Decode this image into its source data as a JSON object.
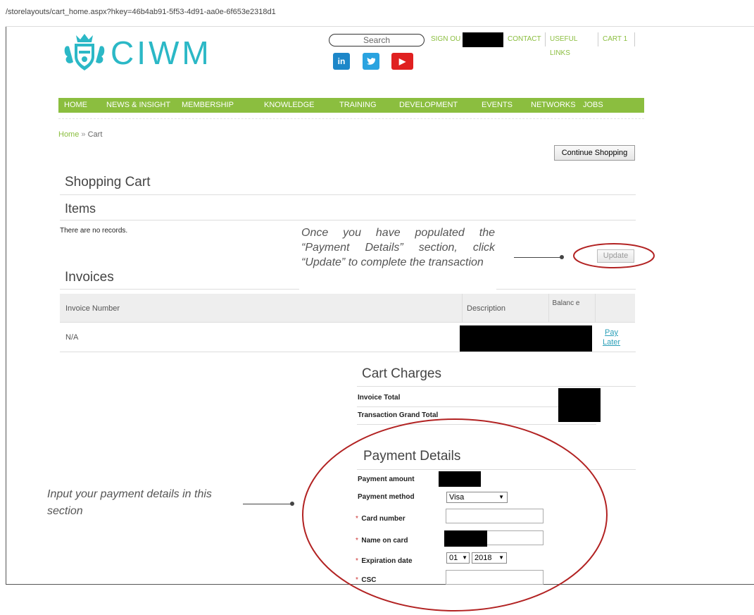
{
  "browser": {
    "url": "/storelayouts/cart_home.aspx?hkey=46b4ab91-5f53-4d91-aa0e-6f653e2318d1"
  },
  "header": {
    "logo_text": "CIWM",
    "search_placeholder": "Search",
    "links": {
      "sign_out": "SIGN OU",
      "contact": "CONTACT",
      "useful_links": "USEFUL LINKS",
      "cart": "CART 1"
    },
    "social": {
      "linkedin": "in",
      "twitter": "t",
      "youtube": "▶"
    }
  },
  "nav": {
    "items": [
      "HOME",
      "NEWS & INSIGHT",
      "MEMBERSHIP",
      "KNOWLEDGE",
      "TRAINING",
      "DEVELOPMENT",
      "EVENTS",
      "NETWORKS",
      "JOBS"
    ]
  },
  "breadcrumb": {
    "home": "Home",
    "sep": "»",
    "current": "Cart"
  },
  "buttons": {
    "continue_shopping": "Continue Shopping",
    "update": "Update"
  },
  "cart": {
    "title": "Shopping Cart",
    "items_title": "Items",
    "no_records": "There are no records."
  },
  "invoices": {
    "title": "Invoices",
    "columns": [
      "Invoice Number",
      "Description",
      "Balanc e"
    ],
    "rows": [
      {
        "invoice_number": "N/A",
        "action_line1": "Pay",
        "action_line2": "Later"
      }
    ]
  },
  "charges": {
    "title": "Cart Charges",
    "invoice_total_label": "Invoice Total",
    "grand_total_label": "Transaction Grand Total"
  },
  "payment": {
    "title": "Payment Details",
    "amount_label": "Payment amount",
    "method_label": "Payment method",
    "method_value": "Visa",
    "card_number_label": "Card number",
    "name_label": "Name on card",
    "expiration_label": "Expiration date",
    "exp_month": "01",
    "exp_year": "2018",
    "csc_label": "CSC",
    "required_mark": "*"
  },
  "annotations": {
    "update_note": "Once you have populated the “Payment Details” section, click “Update” to complete the transaction",
    "payment_note": "Input your payment details in this section"
  },
  "colors": {
    "brand_teal": "#2bb8c6",
    "nav_green": "#8bbe3f",
    "callout_red": "#b22222"
  }
}
